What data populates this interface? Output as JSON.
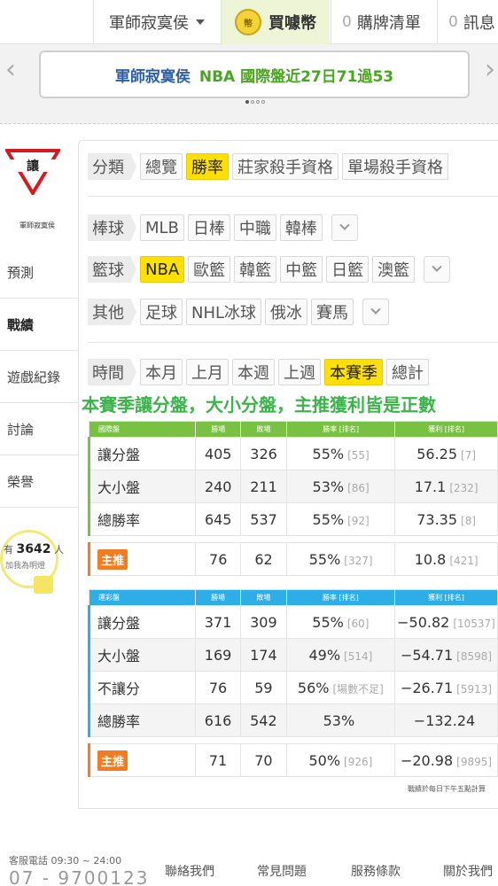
{
  "nav": {
    "user": "軍師寂寞侯",
    "coin_icon_text": "幣",
    "buy": "買噱幣",
    "cart_count": "0",
    "cart": "購牌清單",
    "msg_count": "0",
    "msg": "訊息"
  },
  "banner": {
    "name": "軍師寂寞侯",
    "text": "NBA 國際盤近27日71過53"
  },
  "sidebar": {
    "logo_text": "讓",
    "avatar_name": "軍師寂寞侯",
    "items": [
      "預測",
      "戰績",
      "遊戲紀錄",
      "討論",
      "榮譽"
    ],
    "bulb_prefix": "有",
    "bulb_count": "3642",
    "bulb_suffix": "人",
    "bulb_sub": "加我為明燈"
  },
  "filters": {
    "category": {
      "label": "分類",
      "chips": [
        "總覽",
        "勝率",
        "莊家殺手資格",
        "單場殺手資格"
      ],
      "active": 1
    },
    "baseball": {
      "label": "棒球",
      "chips": [
        "MLB",
        "日棒",
        "中職",
        "韓棒"
      ]
    },
    "basketball": {
      "label": "籃球",
      "chips": [
        "NBA",
        "歐籃",
        "韓籃",
        "中籃",
        "日籃",
        "澳籃"
      ],
      "active": 0
    },
    "other": {
      "label": "其他",
      "chips": [
        "足球",
        "NHL冰球",
        "俄冰",
        "賽馬"
      ]
    },
    "time": {
      "label": "時間",
      "chips": [
        "本月",
        "上月",
        "本週",
        "上週",
        "本賽季",
        "總計"
      ],
      "active": 4
    }
  },
  "season_note": "本賽季讓分盤，大小分盤，主推獲利皆是正數",
  "table1": {
    "headers": [
      "國際盤",
      "勝場",
      "敗場",
      "勝率 [排名]",
      "獲利 [排名]"
    ],
    "rows": [
      {
        "name": "讓分盤",
        "w": "405",
        "l": "326",
        "rate": "55%",
        "rate_rank": "[55]",
        "profit": "56.25",
        "profit_rank": "[7]"
      },
      {
        "name": "大小盤",
        "w": "240",
        "l": "211",
        "rate": "53%",
        "rate_rank": "[86]",
        "profit": "17.1",
        "profit_rank": "[232]"
      },
      {
        "name": "總勝率",
        "w": "645",
        "l": "537",
        "rate": "55%",
        "rate_rank": "[92]",
        "profit": "73.35",
        "profit_rank": "[8]"
      }
    ],
    "main": {
      "tag": "主推",
      "w": "76",
      "l": "62",
      "rate": "55%",
      "rate_rank": "[327]",
      "profit": "10.8",
      "profit_rank": "[421]"
    }
  },
  "table2": {
    "headers": [
      "運彩盤",
      "勝場",
      "敗場",
      "勝率 [排名]",
      "獲利 [排名]"
    ],
    "rows": [
      {
        "name": "讓分盤",
        "w": "371",
        "l": "309",
        "rate": "55%",
        "rate_rank": "[60]",
        "profit": "−50.82",
        "profit_rank": "[10537]"
      },
      {
        "name": "大小盤",
        "w": "169",
        "l": "174",
        "rate": "49%",
        "rate_rank": "[514]",
        "profit": "−54.71",
        "profit_rank": "[8598]"
      },
      {
        "name": "不讓分",
        "w": "76",
        "l": "59",
        "rate": "56%",
        "rate_rank": "[場數不足]",
        "profit": "−26.71",
        "profit_rank": "[5913]"
      },
      {
        "name": "總勝率",
        "w": "616",
        "l": "542",
        "rate": "53%",
        "rate_rank": "",
        "profit": "−132.24",
        "profit_rank": ""
      }
    ],
    "main": {
      "tag": "主推",
      "w": "71",
      "l": "70",
      "rate": "50%",
      "rate_rank": "[926]",
      "profit": "−20.98",
      "profit_rank": "[9895]"
    }
  },
  "footnote": "戰績於每日下午五點計算",
  "footer": {
    "hotline": "客服電話 09:30 ~ 24:00",
    "phone": "07 - 9700123",
    "links": [
      "聯絡我們",
      "常見問題",
      "服務條款",
      "關於我們"
    ]
  },
  "colors": {
    "accent_yellow": "#ffe000",
    "green": "#7ac143",
    "blue": "#2eaee6",
    "orange": "#f47c20",
    "note_green": "#3cb44b"
  }
}
